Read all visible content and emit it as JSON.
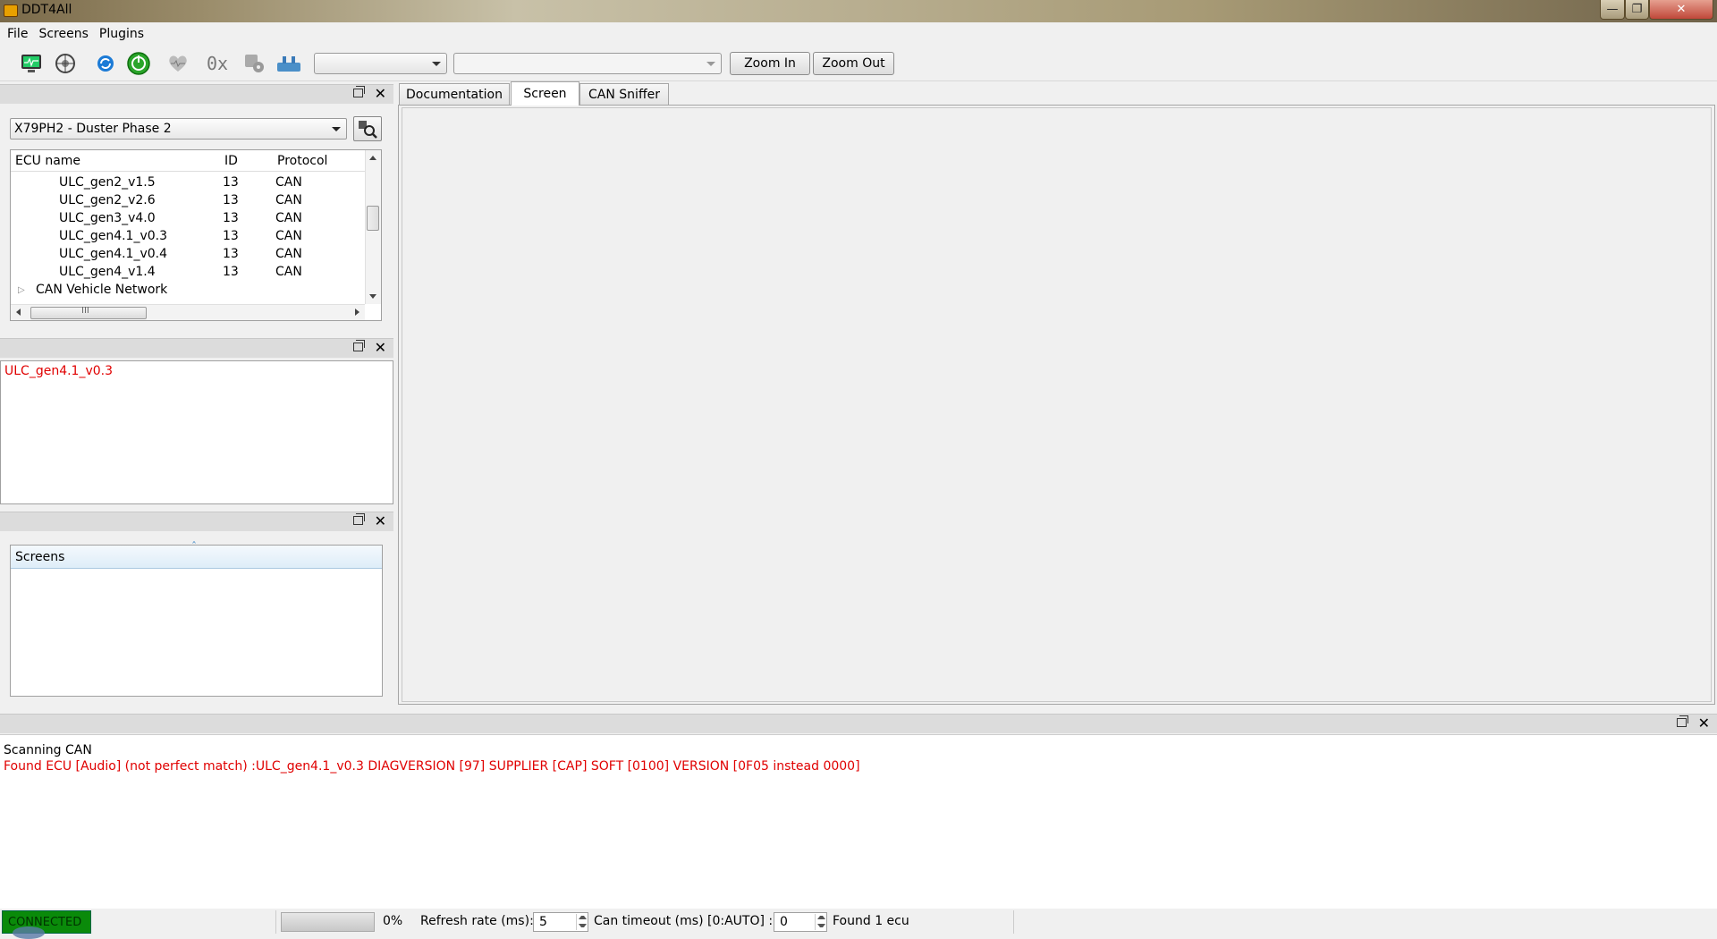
{
  "window": {
    "title": "DDT4All",
    "close_glyph": "✕",
    "min_glyph": "—",
    "max_glyph": "❐"
  },
  "menu": [
    "File",
    "Screens",
    "Plugins"
  ],
  "toolbar": {
    "icons": [
      "monitor-icon",
      "network-scan-icon",
      "refresh-icon",
      "connect-icon",
      "heart-icon",
      "hex-icon",
      "settings-icon",
      "plug-icon"
    ],
    "hex_label": "0x",
    "combo1": "",
    "combo2": "",
    "zoom_in": "Zoom In",
    "zoom_out": "Zoom Out"
  },
  "ecu_selector": {
    "value": "X79PH2 - Duster Phase 2"
  },
  "ecu_tree": {
    "headers": {
      "name": "ECU name",
      "id": "ID",
      "protocol": "Protocol"
    },
    "rows": [
      {
        "name": "ULC_gen2_v1.5",
        "id": "13",
        "protocol": "CAN"
      },
      {
        "name": "ULC_gen2_v2.6",
        "id": "13",
        "protocol": "CAN"
      },
      {
        "name": "ULC_gen3_v4.0",
        "id": "13",
        "protocol": "CAN"
      },
      {
        "name": "ULC_gen4.1_v0.3",
        "id": "13",
        "protocol": "CAN"
      },
      {
        "name": "ULC_gen4.1_v0.4",
        "id": "13",
        "protocol": "CAN"
      },
      {
        "name": "ULC_gen4_v1.4",
        "id": "13",
        "protocol": "CAN"
      }
    ],
    "group": "CAN Vehicle Network",
    "hscroll_grip": "III"
  },
  "ecu_info": {
    "text": "ULC_gen4.1_v0.3"
  },
  "screens": {
    "header": "Screens",
    "sort_caret": "ˆ"
  },
  "tabs": {
    "documentation": "Documentation",
    "screen": "Screen",
    "can_sniffer": "CAN Sniffer",
    "active": "Screen"
  },
  "log": {
    "line1": "Scanning CAN",
    "line2": "Found ECU [Audio] (not perfect match) :ULC_gen4.1_v0.3 DIAGVERSION [97] SUPPLIER [CAP] SOFT [0100] VERSION [0F05 instead 0000]"
  },
  "statusbar": {
    "connection": "CONNECTED",
    "progress": 0,
    "progress_label": "0%",
    "refresh_label": "Refresh rate (ms):",
    "refresh_value": "5",
    "timeout_label": "Can timeout (ms) [0:AUTO] :",
    "timeout_value": "0",
    "found": "Found 1 ecu"
  },
  "colors": {
    "connected_bg": "#0a8a0a",
    "error_text": "#e00000",
    "header_bg": "#dcdcdc"
  }
}
